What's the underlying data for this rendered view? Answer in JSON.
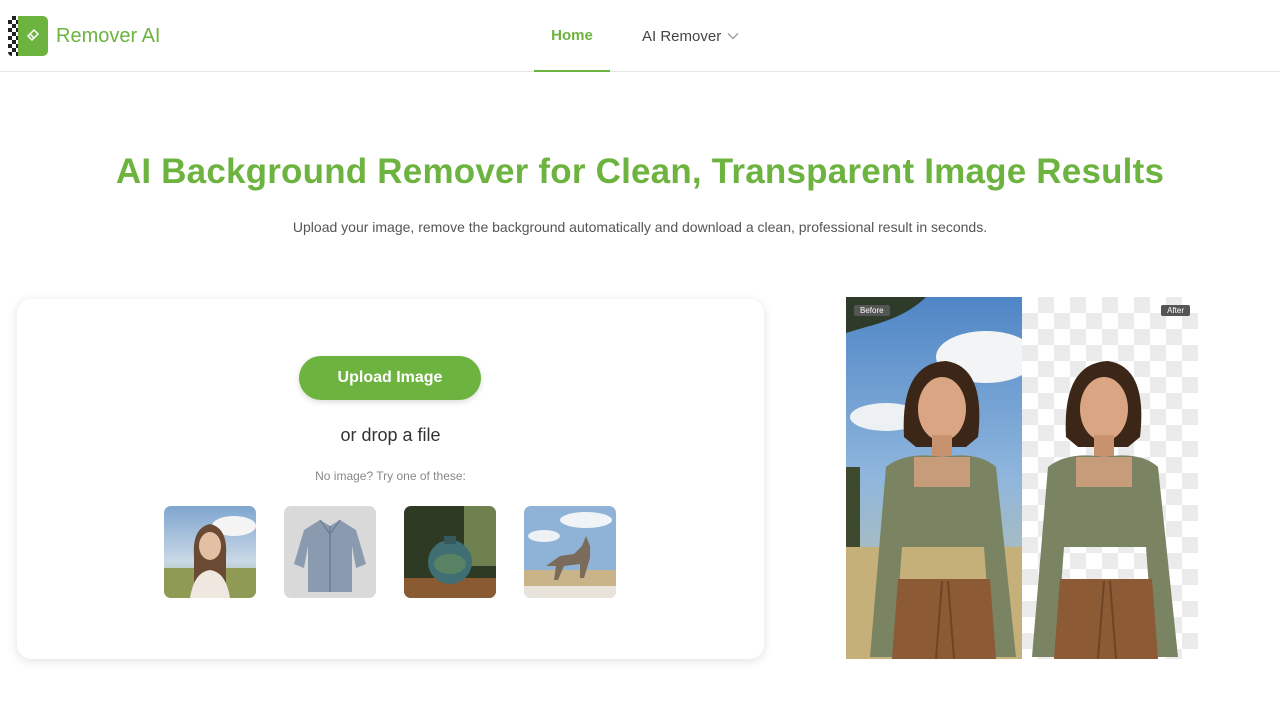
{
  "header": {
    "app_name": "Remover AI",
    "nav": {
      "home": "Home",
      "ai_remover": "AI Remover"
    }
  },
  "hero": {
    "title": "AI Background Remover for Clean, Transparent Image Results",
    "subtitle": "Upload your image, remove the background automatically and download a clean, professional result in seconds."
  },
  "upload": {
    "button_label": "Upload Image",
    "drop_text": "or drop a file",
    "try_text": "No image? Try one of these:",
    "samples": [
      "woman-portrait",
      "shirt",
      "vase",
      "wolf"
    ]
  },
  "preview": {
    "before_label": "Before",
    "after_label": "After"
  },
  "colors": {
    "accent": "#6db33f"
  }
}
